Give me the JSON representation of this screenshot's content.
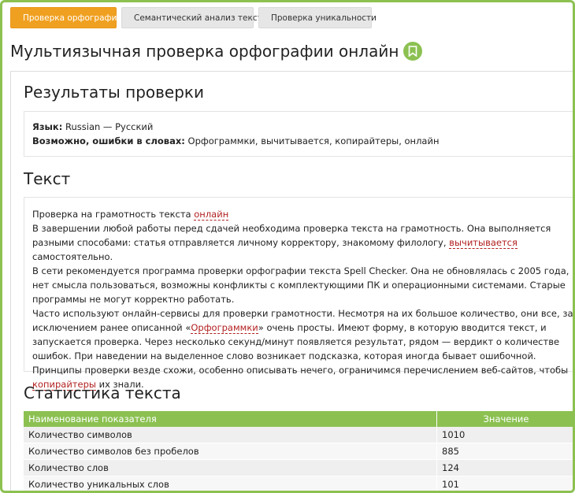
{
  "tabs": [
    {
      "label": "Проверка орфографии",
      "active": true
    },
    {
      "label": "Семантический анализ текста",
      "active": false
    },
    {
      "label": "Проверка уникальности",
      "active": false
    }
  ],
  "page_title": "Мультиязычная проверка орфографии онлайн",
  "results": {
    "heading": "Результаты проверки",
    "language_label": "Язык:",
    "language_value": "Russian — Русский",
    "errors_label": "Возможно, ошибки в словах:",
    "errors_value": "Орфограммки, вычитывается, копирайтеры, онлайн"
  },
  "text_section": {
    "heading": "Текст",
    "l1_pre": "Проверка на грамотность текста ",
    "l1_err": "онлайн",
    "p2_pre": "В завершении любой работы перед сдачей необходима проверка текста на грамотность. Она выполняется разными способами: статья отправляется личному корректору, знакомому филологу, ",
    "p2_err": "вычитывается",
    "p2_post": " самостоятельно.",
    "p3": "В сети рекомендуется программа проверки орфографии текста Spell Checker. Она не обновлялась с 2005 года, нет смысла пользоваться, возможны конфликты с комплектующими ПК и операционными системами. Старые программы не могут корректно работать.",
    "p4_pre": "Часто используют онлайн-сервисы для проверки грамотности. Несмотря на их большое количество, они все, за исключением ранее описанной «",
    "p4_err": "Орфограммки",
    "p4_mid": "» очень просты. Имеют форму, в которую вводится текст, и запускается проверка. Через несколько секунд/минут появляется результат, рядом — вердикт о количестве ошибок. При наведении на выделенное слово возникает подсказка, которая иногда бывает ошибочной. Принципы проверки везде схожи, особенно описывать нечего, ограничимся перечислением веб-сайтов, чтобы ",
    "p4_err2": "копирайтеры",
    "p4_post": " их знали."
  },
  "stats": {
    "heading": "Статистика текста",
    "col_name": "Наименование показателя",
    "col_value": "Значение",
    "rows": [
      {
        "name": "Количество символов",
        "value": "1010"
      },
      {
        "name": "Количество символов без пробелов",
        "value": "885"
      },
      {
        "name": "Количество слов",
        "value": "124"
      },
      {
        "name": "Количество уникальных слов",
        "value": "101"
      }
    ]
  },
  "colors": {
    "accent": "#8cc152",
    "active_tab": "#f0a020",
    "error": "#b21f1f"
  }
}
